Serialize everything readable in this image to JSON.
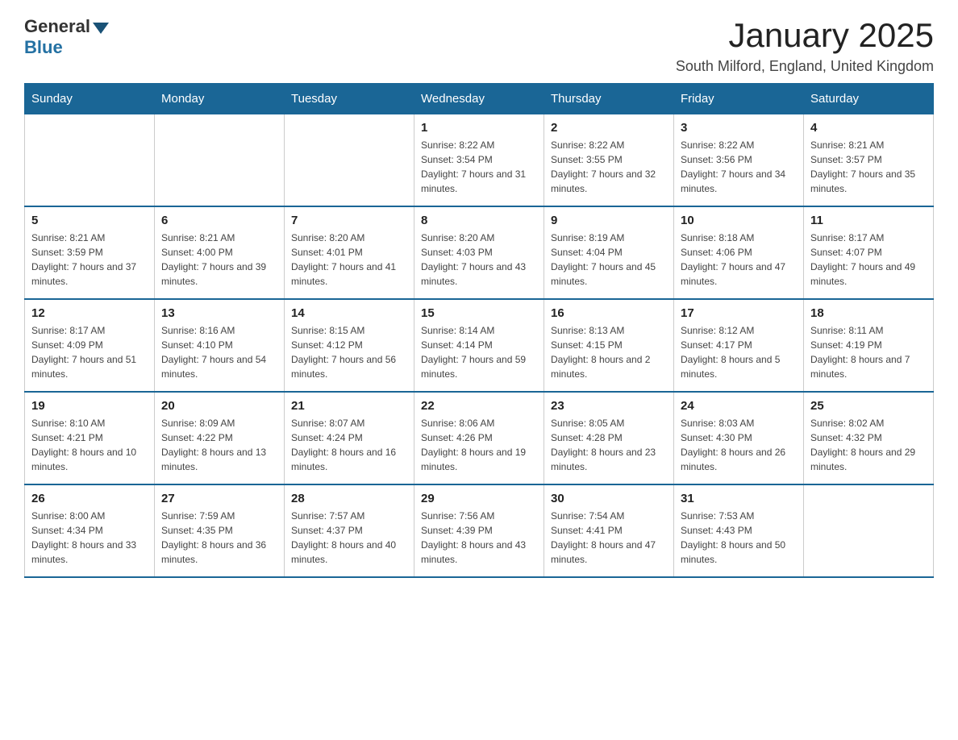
{
  "logo": {
    "general": "General",
    "blue": "Blue"
  },
  "header": {
    "month_year": "January 2025",
    "location": "South Milford, England, United Kingdom"
  },
  "days_of_week": [
    "Sunday",
    "Monday",
    "Tuesday",
    "Wednesday",
    "Thursday",
    "Friday",
    "Saturday"
  ],
  "weeks": [
    [
      {
        "day": "",
        "sunrise": "",
        "sunset": "",
        "daylight": ""
      },
      {
        "day": "",
        "sunrise": "",
        "sunset": "",
        "daylight": ""
      },
      {
        "day": "",
        "sunrise": "",
        "sunset": "",
        "daylight": ""
      },
      {
        "day": "1",
        "sunrise": "Sunrise: 8:22 AM",
        "sunset": "Sunset: 3:54 PM",
        "daylight": "Daylight: 7 hours and 31 minutes."
      },
      {
        "day": "2",
        "sunrise": "Sunrise: 8:22 AM",
        "sunset": "Sunset: 3:55 PM",
        "daylight": "Daylight: 7 hours and 32 minutes."
      },
      {
        "day": "3",
        "sunrise": "Sunrise: 8:22 AM",
        "sunset": "Sunset: 3:56 PM",
        "daylight": "Daylight: 7 hours and 34 minutes."
      },
      {
        "day": "4",
        "sunrise": "Sunrise: 8:21 AM",
        "sunset": "Sunset: 3:57 PM",
        "daylight": "Daylight: 7 hours and 35 minutes."
      }
    ],
    [
      {
        "day": "5",
        "sunrise": "Sunrise: 8:21 AM",
        "sunset": "Sunset: 3:59 PM",
        "daylight": "Daylight: 7 hours and 37 minutes."
      },
      {
        "day": "6",
        "sunrise": "Sunrise: 8:21 AM",
        "sunset": "Sunset: 4:00 PM",
        "daylight": "Daylight: 7 hours and 39 minutes."
      },
      {
        "day": "7",
        "sunrise": "Sunrise: 8:20 AM",
        "sunset": "Sunset: 4:01 PM",
        "daylight": "Daylight: 7 hours and 41 minutes."
      },
      {
        "day": "8",
        "sunrise": "Sunrise: 8:20 AM",
        "sunset": "Sunset: 4:03 PM",
        "daylight": "Daylight: 7 hours and 43 minutes."
      },
      {
        "day": "9",
        "sunrise": "Sunrise: 8:19 AM",
        "sunset": "Sunset: 4:04 PM",
        "daylight": "Daylight: 7 hours and 45 minutes."
      },
      {
        "day": "10",
        "sunrise": "Sunrise: 8:18 AM",
        "sunset": "Sunset: 4:06 PM",
        "daylight": "Daylight: 7 hours and 47 minutes."
      },
      {
        "day": "11",
        "sunrise": "Sunrise: 8:17 AM",
        "sunset": "Sunset: 4:07 PM",
        "daylight": "Daylight: 7 hours and 49 minutes."
      }
    ],
    [
      {
        "day": "12",
        "sunrise": "Sunrise: 8:17 AM",
        "sunset": "Sunset: 4:09 PM",
        "daylight": "Daylight: 7 hours and 51 minutes."
      },
      {
        "day": "13",
        "sunrise": "Sunrise: 8:16 AM",
        "sunset": "Sunset: 4:10 PM",
        "daylight": "Daylight: 7 hours and 54 minutes."
      },
      {
        "day": "14",
        "sunrise": "Sunrise: 8:15 AM",
        "sunset": "Sunset: 4:12 PM",
        "daylight": "Daylight: 7 hours and 56 minutes."
      },
      {
        "day": "15",
        "sunrise": "Sunrise: 8:14 AM",
        "sunset": "Sunset: 4:14 PM",
        "daylight": "Daylight: 7 hours and 59 minutes."
      },
      {
        "day": "16",
        "sunrise": "Sunrise: 8:13 AM",
        "sunset": "Sunset: 4:15 PM",
        "daylight": "Daylight: 8 hours and 2 minutes."
      },
      {
        "day": "17",
        "sunrise": "Sunrise: 8:12 AM",
        "sunset": "Sunset: 4:17 PM",
        "daylight": "Daylight: 8 hours and 5 minutes."
      },
      {
        "day": "18",
        "sunrise": "Sunrise: 8:11 AM",
        "sunset": "Sunset: 4:19 PM",
        "daylight": "Daylight: 8 hours and 7 minutes."
      }
    ],
    [
      {
        "day": "19",
        "sunrise": "Sunrise: 8:10 AM",
        "sunset": "Sunset: 4:21 PM",
        "daylight": "Daylight: 8 hours and 10 minutes."
      },
      {
        "day": "20",
        "sunrise": "Sunrise: 8:09 AM",
        "sunset": "Sunset: 4:22 PM",
        "daylight": "Daylight: 8 hours and 13 minutes."
      },
      {
        "day": "21",
        "sunrise": "Sunrise: 8:07 AM",
        "sunset": "Sunset: 4:24 PM",
        "daylight": "Daylight: 8 hours and 16 minutes."
      },
      {
        "day": "22",
        "sunrise": "Sunrise: 8:06 AM",
        "sunset": "Sunset: 4:26 PM",
        "daylight": "Daylight: 8 hours and 19 minutes."
      },
      {
        "day": "23",
        "sunrise": "Sunrise: 8:05 AM",
        "sunset": "Sunset: 4:28 PM",
        "daylight": "Daylight: 8 hours and 23 minutes."
      },
      {
        "day": "24",
        "sunrise": "Sunrise: 8:03 AM",
        "sunset": "Sunset: 4:30 PM",
        "daylight": "Daylight: 8 hours and 26 minutes."
      },
      {
        "day": "25",
        "sunrise": "Sunrise: 8:02 AM",
        "sunset": "Sunset: 4:32 PM",
        "daylight": "Daylight: 8 hours and 29 minutes."
      }
    ],
    [
      {
        "day": "26",
        "sunrise": "Sunrise: 8:00 AM",
        "sunset": "Sunset: 4:34 PM",
        "daylight": "Daylight: 8 hours and 33 minutes."
      },
      {
        "day": "27",
        "sunrise": "Sunrise: 7:59 AM",
        "sunset": "Sunset: 4:35 PM",
        "daylight": "Daylight: 8 hours and 36 minutes."
      },
      {
        "day": "28",
        "sunrise": "Sunrise: 7:57 AM",
        "sunset": "Sunset: 4:37 PM",
        "daylight": "Daylight: 8 hours and 40 minutes."
      },
      {
        "day": "29",
        "sunrise": "Sunrise: 7:56 AM",
        "sunset": "Sunset: 4:39 PM",
        "daylight": "Daylight: 8 hours and 43 minutes."
      },
      {
        "day": "30",
        "sunrise": "Sunrise: 7:54 AM",
        "sunset": "Sunset: 4:41 PM",
        "daylight": "Daylight: 8 hours and 47 minutes."
      },
      {
        "day": "31",
        "sunrise": "Sunrise: 7:53 AM",
        "sunset": "Sunset: 4:43 PM",
        "daylight": "Daylight: 8 hours and 50 minutes."
      },
      {
        "day": "",
        "sunrise": "",
        "sunset": "",
        "daylight": ""
      }
    ]
  ]
}
